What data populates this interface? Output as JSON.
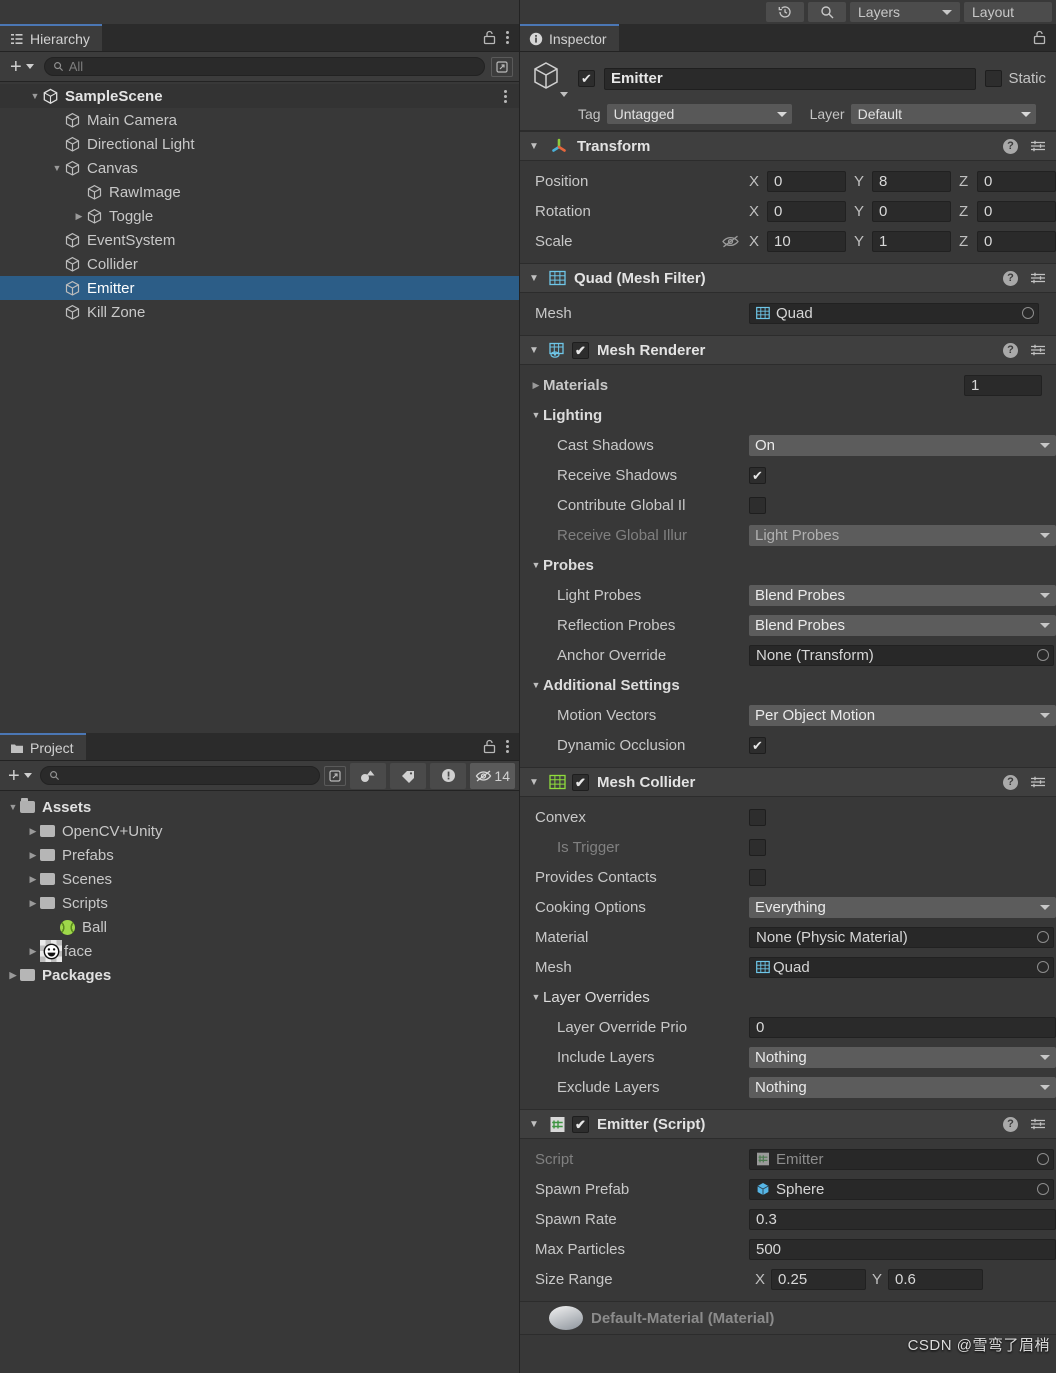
{
  "toolbar": {
    "history_icon": "history-icon",
    "search_icon": "search-icon",
    "layers_label": "Layers",
    "layout_label": "Layout"
  },
  "hierarchy": {
    "tab_label": "Hierarchy",
    "tab_icon": "hierarchy-icon",
    "add_label": "+",
    "search_placeholder": "All",
    "items": [
      {
        "label": "SampleScene",
        "depth": 0,
        "arrow": "down",
        "icon": "unity-scene-icon",
        "selected": false,
        "root": true
      },
      {
        "label": "Main Camera",
        "depth": 1,
        "arrow": "none",
        "icon": "gameobject-cube-icon",
        "selected": false
      },
      {
        "label": "Directional Light",
        "depth": 1,
        "arrow": "none",
        "icon": "gameobject-cube-icon",
        "selected": false
      },
      {
        "label": "Canvas",
        "depth": 1,
        "arrow": "down",
        "icon": "gameobject-cube-icon",
        "selected": false
      },
      {
        "label": "RawImage",
        "depth": 2,
        "arrow": "none",
        "icon": "gameobject-cube-icon",
        "selected": false
      },
      {
        "label": "Toggle",
        "depth": 2,
        "arrow": "right",
        "icon": "gameobject-cube-icon",
        "selected": false
      },
      {
        "label": "EventSystem",
        "depth": 1,
        "arrow": "none",
        "icon": "gameobject-cube-icon",
        "selected": false
      },
      {
        "label": "Collider",
        "depth": 1,
        "arrow": "none",
        "icon": "gameobject-cube-icon",
        "selected": false
      },
      {
        "label": "Emitter",
        "depth": 1,
        "arrow": "none",
        "icon": "gameobject-cube-icon",
        "selected": true
      },
      {
        "label": "Kill Zone",
        "depth": 1,
        "arrow": "none",
        "icon": "gameobject-cube-icon",
        "selected": false
      }
    ]
  },
  "project": {
    "tab_label": "Project",
    "tab_icon": "folder-icon",
    "add_label": "+",
    "search_placeholder": "",
    "filter_count": "14",
    "items": [
      {
        "label": "Assets",
        "depth": 0,
        "arrow": "down",
        "icon": "folder-open-icon",
        "bold": true
      },
      {
        "label": "OpenCV+Unity",
        "depth": 1,
        "arrow": "right",
        "icon": "folder-icon",
        "bold": false
      },
      {
        "label": "Prefabs",
        "depth": 1,
        "arrow": "right",
        "icon": "folder-icon",
        "bold": false
      },
      {
        "label": "Scenes",
        "depth": 1,
        "arrow": "right",
        "icon": "folder-icon",
        "bold": false
      },
      {
        "label": "Scripts",
        "depth": 1,
        "arrow": "right",
        "icon": "folder-icon",
        "bold": false
      },
      {
        "label": "Ball",
        "depth": 2,
        "arrow": "none",
        "icon": "physic-material-icon",
        "bold": false
      },
      {
        "label": "face",
        "depth": 1,
        "arrow": "right",
        "icon": "texture-face-icon",
        "bold": false
      },
      {
        "label": "Packages",
        "depth": 0,
        "arrow": "right",
        "icon": "folder-icon",
        "bold": true
      }
    ]
  },
  "inspector": {
    "tab_label": "Inspector",
    "tab_icon": "info-icon",
    "object_name": "Emitter",
    "object_enabled": true,
    "static_label": "Static",
    "static_checked": false,
    "tag_label": "Tag",
    "tag_value": "Untagged",
    "layer_label": "Layer",
    "layer_value": "Default",
    "components": [
      {
        "title": "Transform",
        "icon": "transform-axis-icon",
        "has_toggle": false,
        "rows": [
          {
            "label": "Position",
            "x": "0",
            "y": "8",
            "z": "0"
          },
          {
            "label": "Rotation",
            "x": "0",
            "y": "0",
            "z": "0"
          },
          {
            "label": "Scale",
            "x": "10",
            "y": "1",
            "z": "0",
            "constrain_icon": "constrain-proportions-off-icon"
          }
        ],
        "axis_labels": [
          "X",
          "Y",
          "Z"
        ]
      },
      {
        "title": "Quad (Mesh Filter)",
        "icon": "mesh-filter-icon",
        "has_toggle": false,
        "mesh_label": "Mesh",
        "mesh_value": "Quad"
      },
      {
        "title": "Mesh Renderer",
        "icon": "mesh-renderer-icon",
        "has_toggle": true,
        "enabled": true,
        "materials_label": "Materials",
        "materials_count": "1",
        "lighting_label": "Lighting",
        "cast_shadows_label": "Cast Shadows",
        "cast_shadows_value": "On",
        "receive_shadows_label": "Receive Shadows",
        "receive_shadows_checked": true,
        "contribute_gi_label": "Contribute Global Il",
        "contribute_gi_checked": false,
        "receive_gi_label": "Receive Global Illur",
        "receive_gi_value": "Light Probes",
        "probes_label": "Probes",
        "light_probes_label": "Light Probes",
        "light_probes_value": "Blend Probes",
        "reflection_probes_label": "Reflection Probes",
        "reflection_probes_value": "Blend Probes",
        "anchor_override_label": "Anchor Override",
        "anchor_override_value": "None (Transform)",
        "additional_settings_label": "Additional Settings",
        "motion_vectors_label": "Motion Vectors",
        "motion_vectors_value": "Per Object Motion",
        "dynamic_occlusion_label": "Dynamic Occlusion",
        "dynamic_occlusion_checked": true
      },
      {
        "title": "Mesh Collider",
        "icon": "mesh-collider-icon",
        "has_toggle": true,
        "enabled": true,
        "convex_label": "Convex",
        "convex_checked": false,
        "is_trigger_label": "Is Trigger",
        "is_trigger_checked": false,
        "provides_contacts_label": "Provides Contacts",
        "provides_contacts_checked": false,
        "cooking_options_label": "Cooking Options",
        "cooking_options_value": "Everything",
        "material_label": "Material",
        "material_value": "None (Physic Material)",
        "mesh_label": "Mesh",
        "mesh_value": "Quad",
        "layer_overrides_label": "Layer Overrides",
        "layer_override_priority_label": "Layer Override Prio",
        "layer_override_priority_value": "0",
        "include_layers_label": "Include Layers",
        "include_layers_value": "Nothing",
        "exclude_layers_label": "Exclude Layers",
        "exclude_layers_value": "Nothing"
      },
      {
        "title": "Emitter (Script)",
        "icon": "cs-script-icon",
        "has_toggle": true,
        "enabled": true,
        "script_label": "Script",
        "script_value": "Emitter",
        "spawn_prefab_label": "Spawn Prefab",
        "spawn_prefab_value": "Sphere",
        "spawn_rate_label": "Spawn Rate",
        "spawn_rate_value": "0.3",
        "max_particles_label": "Max Particles",
        "max_particles_value": "500",
        "size_range_label": "Size Range",
        "size_range_x": "0.25",
        "size_range_y": "0.6",
        "size_axis_x": "X",
        "size_axis_y": "Y"
      },
      {
        "title": "Default-Material (Material)",
        "icon": "material-sphere-icon",
        "partial": true
      }
    ],
    "help_icon": "help-icon",
    "preset_icon": "preset-settings-icon"
  },
  "watermark": "CSDN @雪弯了眉梢"
}
